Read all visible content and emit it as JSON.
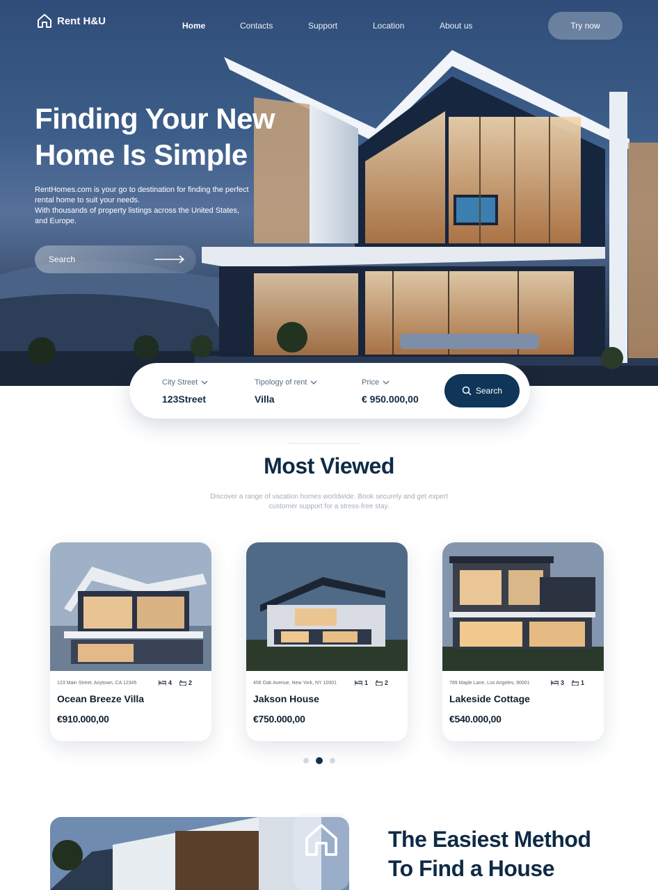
{
  "nav": {
    "logo_text": "Rent H&U",
    "links": [
      "Home",
      "Contacts",
      "Support",
      "Location",
      "About us"
    ],
    "cta": "Try now"
  },
  "hero": {
    "title_line1": "Finding Your New",
    "title_line2": "Home Is Simple",
    "desc_line1": "RentHomes.com is your go to destination for finding the perfect rental home to suit your needs.",
    "desc_line2": "With thousands of property listings across the United States, and Europe.",
    "search_label": "Search"
  },
  "search_bar": {
    "city_label": "City Street",
    "city_value": "123Street",
    "type_label": "Tipology of rent",
    "type_value": "Villa",
    "price_label": "Price",
    "price_value": "€ 950.000,00",
    "button_label": "Search"
  },
  "most_viewed": {
    "title": "Most Viewed",
    "subtitle": "Discover a range of vacation homes worldwide. Book securely and get expert customer support for a stress-free stay.",
    "cards": [
      {
        "address": "123 Main Street, Anytown, CA 12345",
        "beds": "4",
        "baths": "2",
        "name": "Ocean Breeze Villa",
        "price": "€910.000,00"
      },
      {
        "address": "456 Oak Avenue, New York, NY 10001",
        "beds": "1",
        "baths": "2",
        "name": "Jakson House",
        "price": "€750.000,00"
      },
      {
        "address": "789 Maple Lane, Los Angeles, 90001",
        "beds": "3",
        "baths": "1",
        "name": "Lakeside Cottage",
        "price": "€540.000,00"
      }
    ],
    "carousel_active_index": 1
  },
  "bottom": {
    "title_line1": "The Easiest Method",
    "title_line2": "To Find a House"
  },
  "colors": {
    "primary": "#0f3558",
    "heading": "#0f2a45",
    "hero_sky": "#3d5e8a"
  }
}
